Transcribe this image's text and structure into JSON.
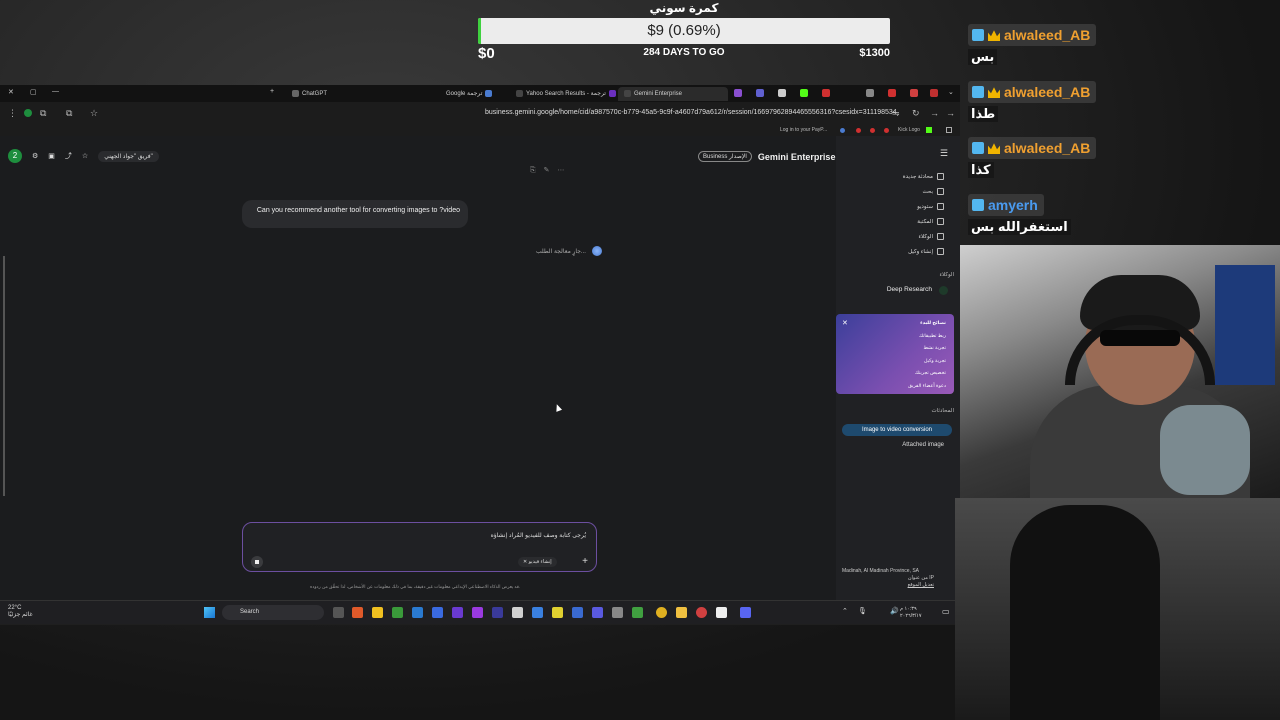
{
  "goal": {
    "title": "كمرة سوني",
    "value": "$9 (0.69%)",
    "progress_percent": 0.69,
    "min": "$0",
    "days": "284 DAYS TO GO",
    "max": "$1300"
  },
  "browser": {
    "tabs": [
      {
        "label": "ChatGPT"
      },
      {
        "label": "Google ترجمة"
      },
      {
        "label": "Yahoo Search Results - ترجمة"
      },
      {
        "label": "Gemini Enterprise",
        "active": true
      }
    ],
    "url": "business.gemini.google/home/cid/a987570c-b779-45a5-9c9f-a4607d79a612/r/session/16697962894465556316?csesidx=311198534",
    "bookmarks": [
      "Log in to your PayP...",
      "Kick Logo"
    ]
  },
  "app": {
    "brand_badge": "Business الإصدار",
    "brand_name": "Gemini Enterprise",
    "avatar_letter": "2",
    "session_chip": "فريق \"جواد الجهني\"",
    "user_message": "Can you recommend another tool for converting images to ?video",
    "thinking": "جارٍ معالجة الطلب...",
    "composer": {
      "placeholder": "يُرجى كتابة وصف للفيديو المُراد إنشاؤه",
      "chip": "إنشاء فيديو"
    },
    "disclaimer": "قد يعرض الذكاء الاصطناعي الإبداعي معلومات غير دقيقة، بما في ذلك معلومات عن الأشخاص، لذا تحقَّق من ردوده."
  },
  "sidebar": {
    "menu": [
      "محادثة جديدة",
      "بحث",
      "ستوديو",
      "المكتبة",
      "الوكلاء",
      "إنشاء وكيل"
    ],
    "agents_label": "الوكلاء",
    "deep_research": "Deep Research",
    "tips_title": "نصائح للبدء",
    "tips": [
      "ربط تطبيقاتك",
      "تجربة نشط",
      "تجربة وكيل",
      "تخصيص تجربتك",
      "دعوة أعضاء الفريق"
    ],
    "conversations_label": "المحادثات",
    "conversations": [
      "Image to video conversion",
      "Attached image"
    ],
    "location": "Madinah, Al Madinah Province, SA",
    "location_sub": "من عنوان IP",
    "location_link": "تعديل الموقع"
  },
  "taskbar": {
    "weather_temp": "22°C",
    "weather_desc": "غائم جزئيًا",
    "search_label": "Search",
    "clock_time": "١٠:٣٩ م",
    "clock_date": "٢٠٢٦/٣/١٧"
  },
  "chat": [
    {
      "user": "alwaleed_AB",
      "message": "بس",
      "color": "#f0a030"
    },
    {
      "user": "alwaleed_AB",
      "message": "طذا",
      "color": "#f0a030"
    },
    {
      "user": "alwaleed_AB",
      "message": "كذا",
      "color": "#f0a030"
    },
    {
      "user": "amyerh",
      "message": "استغفرالله بس",
      "color": "#4a9bf0"
    }
  ]
}
